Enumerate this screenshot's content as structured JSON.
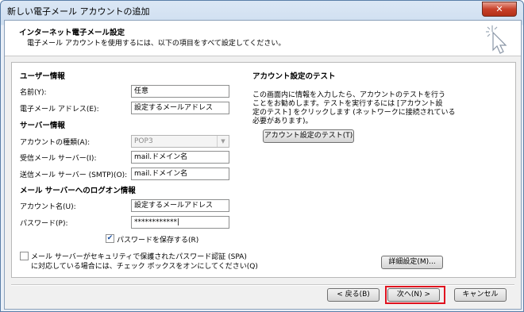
{
  "window": {
    "title": "新しい電子メール アカウントの追加",
    "close_label": "✕"
  },
  "header": {
    "title": "インターネット電子メール設定",
    "subtitle": "電子メール アカウントを使用するには、以下の項目をすべて設定してください。"
  },
  "user_info": {
    "heading": "ユーザー情報",
    "name_label": "名前(Y):",
    "name_value": "任意",
    "email_label": "電子メール アドレス(E):",
    "email_value": "設定するメールアドレス"
  },
  "server_info": {
    "heading": "サーバー情報",
    "account_type_label": "アカウントの種類(A):",
    "account_type_value": "POP3",
    "incoming_label": "受信メール サーバー(I):",
    "incoming_value": "mail.ドメイン名",
    "outgoing_label": "送信メール サーバー (SMTP)(O):",
    "outgoing_value": "mail.ドメイン名"
  },
  "logon_info": {
    "heading": "メール サーバーへのログオン情報",
    "account_name_label": "アカウント名(U):",
    "account_name_value": "設定するメールアドレス",
    "password_label": "パスワード(P):",
    "password_value": "************|",
    "remember_label": "パスワードを保存する(R)",
    "spa_label_line1": "メール サーバーがセキュリティで保護されたパスワード認証 (SPA)",
    "spa_label_line2": "に対応している場合には、チェック ボックスをオンにしてください(Q)"
  },
  "test_section": {
    "heading": "アカウント設定のテスト",
    "desc_line1": "この画面内に情報を入力したら、アカウントのテストを行う",
    "desc_line2": "ことをお勧めします。テストを実行するには [アカウント設",
    "desc_line3": "定のテスト] をクリックします (ネットワークに接続されている",
    "desc_line4": "必要があります)。",
    "test_button": "アカウント設定のテスト(T)",
    "more_settings_button": "詳細設定(M)..."
  },
  "footer": {
    "back_button": "< 戻る(B)",
    "next_button": "次へ(N) >",
    "cancel_button": "キャンセル"
  }
}
